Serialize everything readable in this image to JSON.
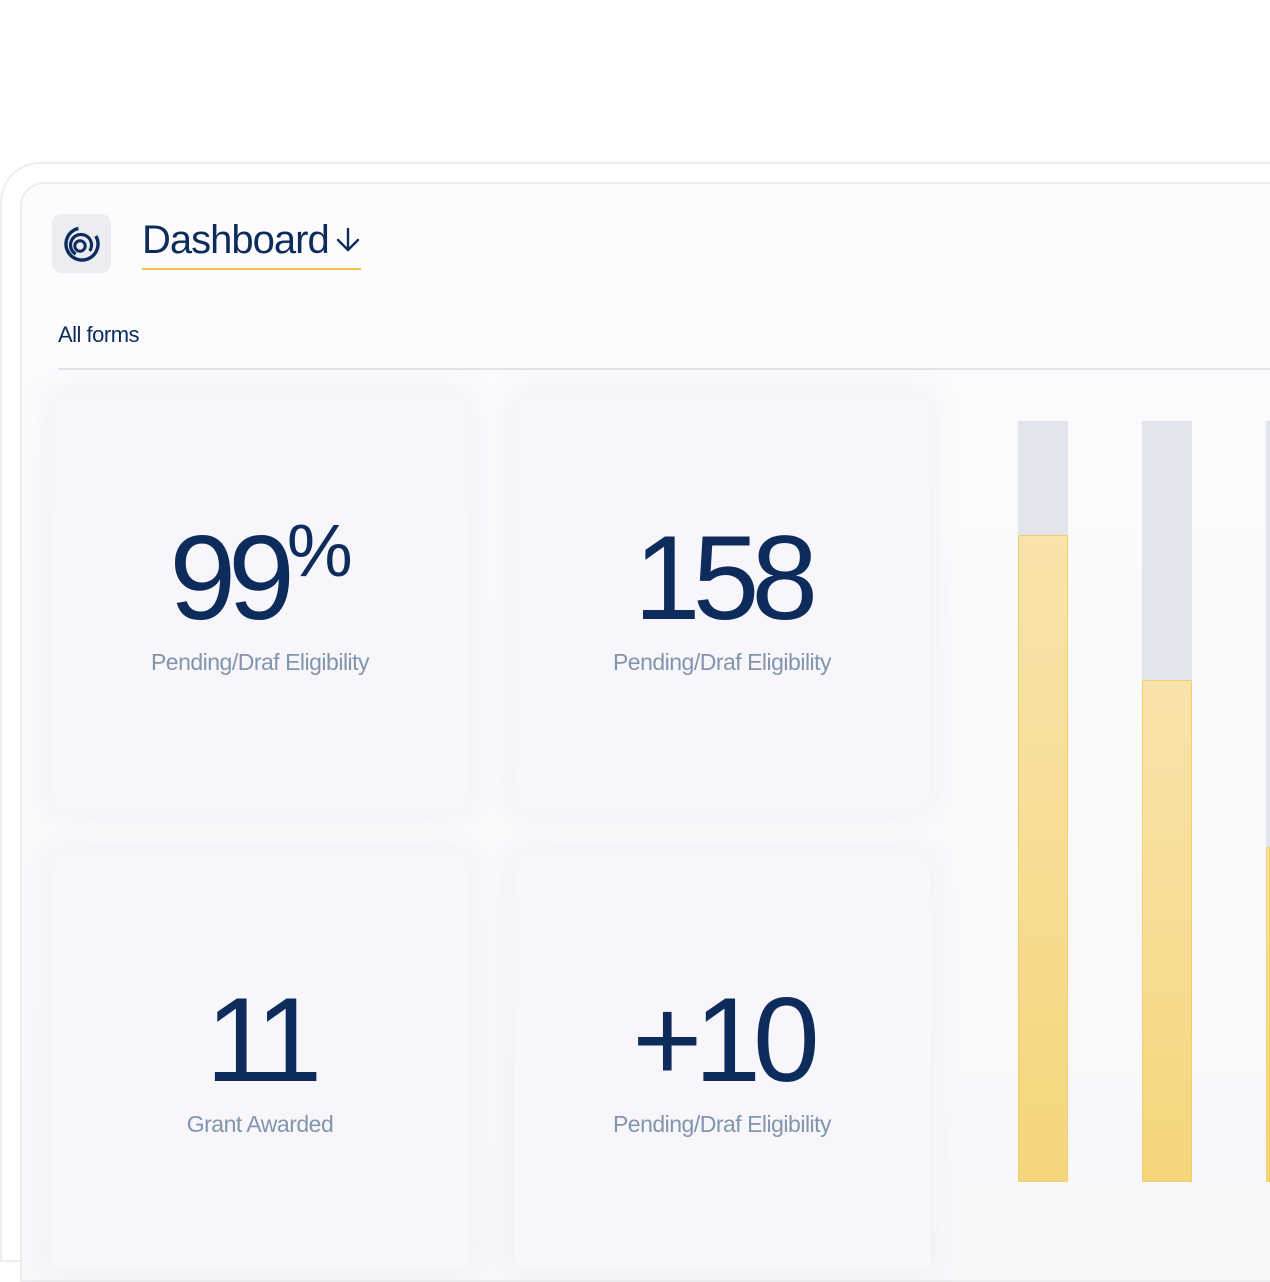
{
  "header": {
    "title": "Dashboard",
    "section_label": "All forms"
  },
  "stats": [
    {
      "value": "99",
      "unit": "%",
      "label": "Pending/Draf Eligibility"
    },
    {
      "value": "158",
      "label": "Pending/Draf Eligibility"
    },
    {
      "value": "11",
      "label": "Grant Awarded"
    },
    {
      "value": "+10",
      "label": "Pending/Draf Eligibility"
    }
  ],
  "bars": [
    {
      "fill_fraction": 0.85
    },
    {
      "fill_fraction": 0.66
    },
    {
      "fill_fraction": 0.44
    }
  ],
  "colors": {
    "primary": "#0d2c5c",
    "accent": "#f2c24a",
    "muted_text": "#8395ad",
    "bar_fill": "#f6d67c",
    "bar_track": "#e3e5ec"
  },
  "icons": {
    "logo": "swirl-logo-icon",
    "dropdown": "arrow-down-icon"
  }
}
